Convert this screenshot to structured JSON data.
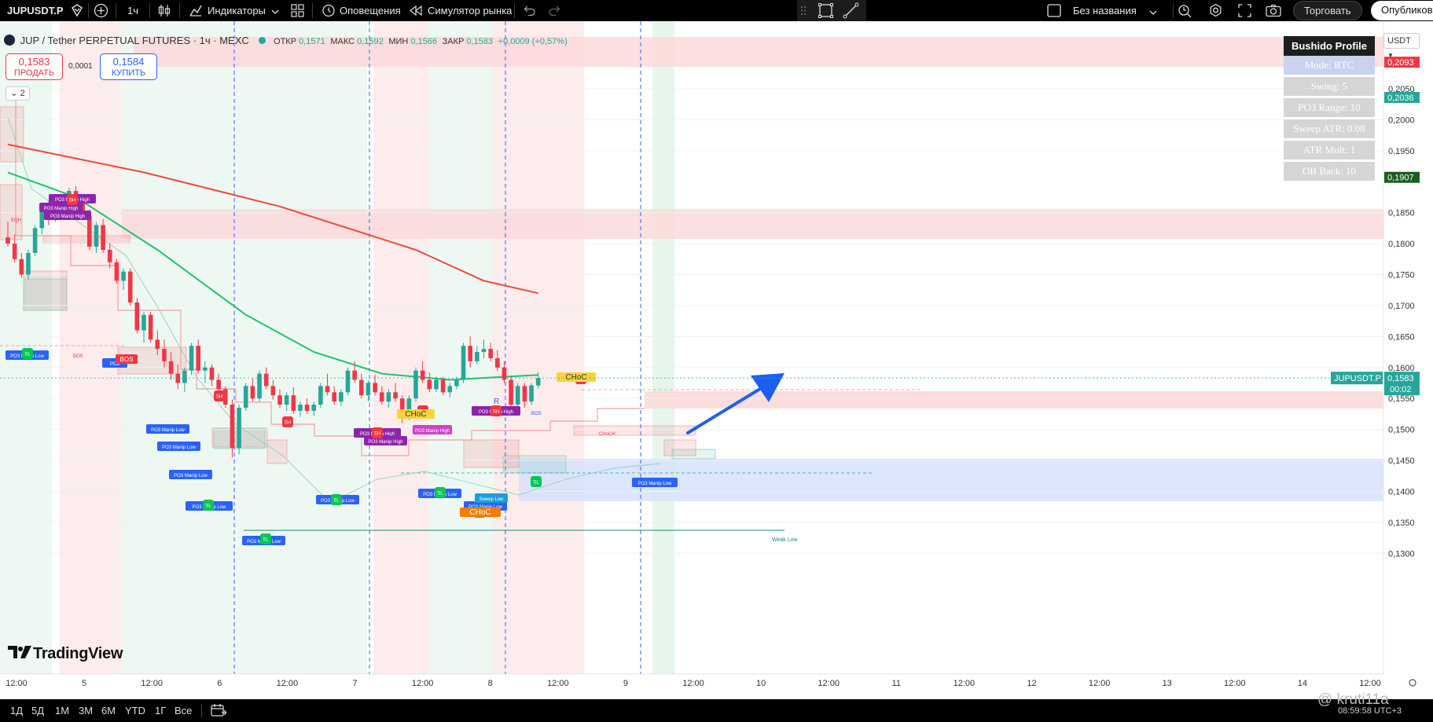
{
  "toolbar": {
    "symbol": "JUPUSDT.P",
    "interval": "1ч",
    "indicators": "Индикаторы",
    "alerts": "Оповещения",
    "replay": "Симулятор рынка",
    "layout_name": "Без названия",
    "trade": "Торговать",
    "publish": "Опубликов"
  },
  "legend": {
    "title": "JUP / Tether PERPETUAL FUTURES · 1ч · MEXC",
    "o_label": "ОТКР",
    "o": "0,1571",
    "h_label": "МАКС",
    "h": "0,1592",
    "l_label": "МИН",
    "l": "0,1566",
    "c_label": "ЗАКР",
    "c": "0,1583",
    "change": "+0,0009 (+0,57%)"
  },
  "trade_panel": {
    "sell_price": "0,1583",
    "sell_label": "ПРОДАТЬ",
    "spread": "0,0001",
    "buy_price": "0,1584",
    "buy_label": "КУПИТЬ",
    "collapsed_count": "2"
  },
  "bushido": {
    "title": "Bushido Profile",
    "rows": [
      "Mode: BTC",
      "Swing: 5",
      "PO3 Range: 10",
      "Sweep ATR: 0.08",
      "ATR Mult: 1",
      "OB Back: 10"
    ]
  },
  "currency": "USDT",
  "price_axis": {
    "labels": [
      "0,2050",
      "0,2000",
      "0,1950",
      "0,1850",
      "0,1800",
      "0,1750",
      "0,1700",
      "0,1650",
      "0,1600",
      "0,1550",
      "0,1500",
      "0,1450",
      "0,1400",
      "0,1350",
      "0,1300"
    ],
    "tags": [
      {
        "text": "0,2093",
        "color": "#f23645"
      },
      {
        "text": "0,2036",
        "color": "#26a69a"
      },
      {
        "text": "0,1907",
        "color": "#1b5e20"
      }
    ],
    "last_symbol": "JUPUSDT.P",
    "last_price": "0,1583",
    "countdown": "00:02"
  },
  "time_axis": [
    "12:00",
    "5",
    "12:00",
    "6",
    "12:00",
    "7",
    "12:00",
    "8",
    "12:00",
    "9",
    "12:00",
    "10",
    "12:00",
    "11",
    "12:00",
    "12",
    "12:00",
    "13",
    "12:00",
    "14",
    "12:00"
  ],
  "annotations": {
    "sh": "SH",
    "sl": "SL",
    "bos": "BOS",
    "choch": "CHoCH",
    "choch_short": "CHoC",
    "po3_high": "PO3 Manip High",
    "po3_low": "PO3 Manip Low",
    "sweep_low": "Sweep Low",
    "weak_low": "Weak Low",
    "eqh": "EQH",
    "r": "R",
    "po3": "PO3",
    "low": "Low",
    "bos_small": "BOS"
  },
  "periods": [
    "1Д",
    "5Д",
    "1М",
    "3М",
    "6М",
    "YTD",
    "1Г",
    "Все"
  ],
  "brand": "TradingView",
  "watermark": "@ kruti11a",
  "clock": "08:59:58 UTC+3",
  "colors": {
    "up": "#26a69a",
    "down": "#f23645",
    "ema_fast": "#1fc46b",
    "ema_slow": "#f2473b",
    "arrow": "#1e5ff2"
  },
  "chart_data": {
    "type": "candlestick",
    "x_start": "4 12:00",
    "ylim": [
      0.127,
      0.211
    ],
    "candles": [
      [
        0.181,
        0.1835,
        0.1795,
        0.18
      ],
      [
        0.18,
        0.1815,
        0.177,
        0.1775
      ],
      [
        0.1775,
        0.1785,
        0.1745,
        0.175
      ],
      [
        0.175,
        0.179,
        0.1742,
        0.1785
      ],
      [
        0.1785,
        0.183,
        0.178,
        0.1825
      ],
      [
        0.1825,
        0.186,
        0.1815,
        0.1855
      ],
      [
        0.1855,
        0.1868,
        0.183,
        0.184
      ],
      [
        0.184,
        0.187,
        0.1835,
        0.186
      ],
      [
        0.186,
        0.188,
        0.185,
        0.1872
      ],
      [
        0.1872,
        0.189,
        0.186,
        0.1885
      ],
      [
        0.1885,
        0.1893,
        0.186,
        0.1865
      ],
      [
        0.1865,
        0.188,
        0.184,
        0.1845
      ],
      [
        0.1845,
        0.1855,
        0.179,
        0.1795
      ],
      [
        0.1795,
        0.1835,
        0.1785,
        0.183
      ],
      [
        0.183,
        0.184,
        0.1785,
        0.179
      ],
      [
        0.179,
        0.18,
        0.176,
        0.177
      ],
      [
        0.177,
        0.1775,
        0.1735,
        0.174
      ],
      [
        0.174,
        0.176,
        0.1725,
        0.1755
      ],
      [
        0.1755,
        0.176,
        0.17,
        0.1705
      ],
      [
        0.1705,
        0.1712,
        0.1655,
        0.166
      ],
      [
        0.166,
        0.169,
        0.164,
        0.1685
      ],
      [
        0.1685,
        0.169,
        0.164,
        0.1645
      ],
      [
        0.1645,
        0.166,
        0.162,
        0.163
      ],
      [
        0.163,
        0.1645,
        0.16,
        0.161
      ],
      [
        0.161,
        0.1625,
        0.158,
        0.159
      ],
      [
        0.159,
        0.1605,
        0.1565,
        0.1575
      ],
      [
        0.1575,
        0.16,
        0.156,
        0.1595
      ],
      [
        0.1595,
        0.164,
        0.1588,
        0.1635
      ],
      [
        0.1635,
        0.1645,
        0.159,
        0.1595
      ],
      [
        0.1595,
        0.161,
        0.1575,
        0.16
      ],
      [
        0.16,
        0.1605,
        0.157,
        0.158
      ],
      [
        0.158,
        0.159,
        0.1555,
        0.1565
      ],
      [
        0.1565,
        0.157,
        0.1535,
        0.154
      ],
      [
        0.154,
        0.1548,
        0.1455,
        0.147
      ],
      [
        0.147,
        0.154,
        0.146,
        0.1535
      ],
      [
        0.1535,
        0.1575,
        0.153,
        0.157
      ],
      [
        0.157,
        0.1582,
        0.1545,
        0.155
      ],
      [
        0.155,
        0.1595,
        0.1545,
        0.159
      ],
      [
        0.159,
        0.16,
        0.1565,
        0.157
      ],
      [
        0.157,
        0.158,
        0.1548,
        0.1555
      ],
      [
        0.1555,
        0.1565,
        0.1535,
        0.154
      ],
      [
        0.154,
        0.156,
        0.153,
        0.1555
      ],
      [
        0.1555,
        0.1568,
        0.1525,
        0.153
      ],
      [
        0.153,
        0.1545,
        0.152,
        0.154
      ],
      [
        0.154,
        0.155,
        0.1525,
        0.153
      ],
      [
        0.153,
        0.1545,
        0.1522,
        0.154
      ],
      [
        0.154,
        0.1575,
        0.1535,
        0.157
      ],
      [
        0.157,
        0.159,
        0.1555,
        0.156
      ],
      [
        0.156,
        0.157,
        0.154,
        0.1545
      ],
      [
        0.1545,
        0.1565,
        0.1538,
        0.156
      ],
      [
        0.156,
        0.16,
        0.1555,
        0.1595
      ],
      [
        0.1595,
        0.161,
        0.1575,
        0.158
      ],
      [
        0.158,
        0.159,
        0.155,
        0.1555
      ],
      [
        0.1555,
        0.158,
        0.1545,
        0.1575
      ],
      [
        0.1575,
        0.1588,
        0.1555,
        0.156
      ],
      [
        0.156,
        0.157,
        0.154,
        0.1545
      ],
      [
        0.1545,
        0.1565,
        0.1535,
        0.156
      ],
      [
        0.156,
        0.1575,
        0.1545,
        0.155
      ],
      [
        0.155,
        0.1555,
        0.151,
        0.1525
      ],
      [
        0.1525,
        0.1555,
        0.1515,
        0.155
      ],
      [
        0.155,
        0.16,
        0.1545,
        0.1595
      ],
      [
        0.1595,
        0.161,
        0.1575,
        0.158
      ],
      [
        0.158,
        0.1592,
        0.156,
        0.1565
      ],
      [
        0.1565,
        0.1585,
        0.156,
        0.158
      ],
      [
        0.158,
        0.1585,
        0.1555,
        0.156
      ],
      [
        0.156,
        0.1575,
        0.1552,
        0.157
      ],
      [
        0.157,
        0.1585,
        0.1565,
        0.158
      ],
      [
        0.158,
        0.164,
        0.1575,
        0.1635
      ],
      [
        0.1635,
        0.165,
        0.16,
        0.161
      ],
      [
        0.161,
        0.1635,
        0.1605,
        0.1625
      ],
      [
        0.1625,
        0.1645,
        0.1615,
        0.163
      ],
      [
        0.163,
        0.164,
        0.161,
        0.1615
      ],
      [
        0.1615,
        0.1628,
        0.1595,
        0.16
      ],
      [
        0.16,
        0.161,
        0.1575,
        0.158
      ],
      [
        0.158,
        0.1585,
        0.153,
        0.154
      ],
      [
        0.154,
        0.1575,
        0.1535,
        0.157
      ],
      [
        0.157,
        0.1575,
        0.1535,
        0.1545
      ],
      [
        0.1545,
        0.1575,
        0.154,
        0.1571
      ],
      [
        0.1571,
        0.1592,
        0.1566,
        0.1583
      ]
    ],
    "ema_fast": [
      [
        0,
        0.1915
      ],
      [
        10,
        0.1875
      ],
      [
        22,
        0.179
      ],
      [
        35,
        0.1685
      ],
      [
        45,
        0.1625
      ],
      [
        55,
        0.159
      ],
      [
        65,
        0.158
      ],
      [
        78,
        0.1588
      ]
    ],
    "ema_slow": [
      [
        0,
        0.196
      ],
      [
        20,
        0.1915
      ],
      [
        40,
        0.186
      ],
      [
        60,
        0.179
      ],
      [
        70,
        0.174
      ],
      [
        78,
        0.172
      ]
    ]
  }
}
